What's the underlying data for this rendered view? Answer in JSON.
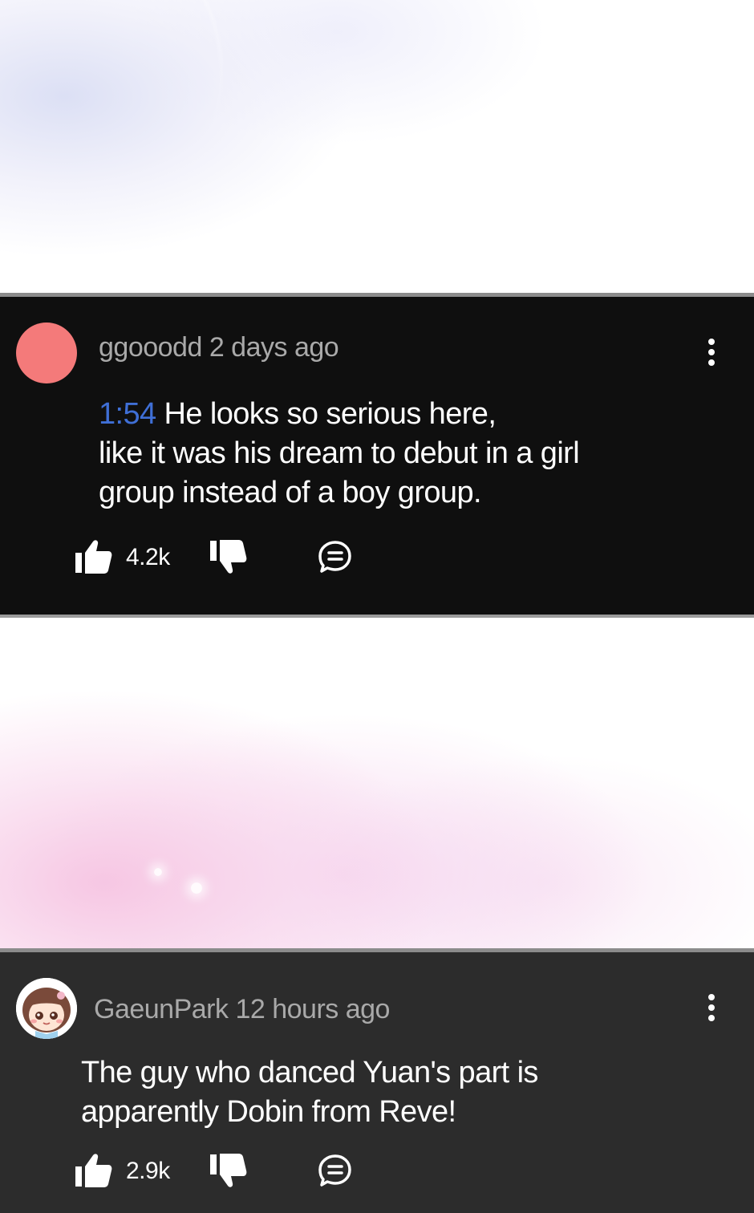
{
  "comments": [
    {
      "author": "ggooodd",
      "time": "2 days ago",
      "timestamp_link": "1:54",
      "lines": [
        "He looks so serious here,",
        "like it was his dream to debut in a girl",
        "group instead of a boy group."
      ],
      "likes": "4.2k",
      "avatar_color": "#f47a7a"
    },
    {
      "author": "GaeunPark",
      "time": "12 hours ago",
      "lines": [
        "The guy who danced Yuan's part is",
        "apparently Dobin from Reve!"
      ],
      "likes": "2.9k"
    }
  ],
  "colors": {
    "timestamp_link": "#3f6fd6",
    "meta_text": "#a9a9a9",
    "comment1_bg": "#0f0f0f",
    "comment2_bg": "#2c2c2c"
  },
  "icons": [
    "thumbs-up-icon",
    "thumbs-down-icon",
    "reply-icon",
    "more-options-icon"
  ]
}
